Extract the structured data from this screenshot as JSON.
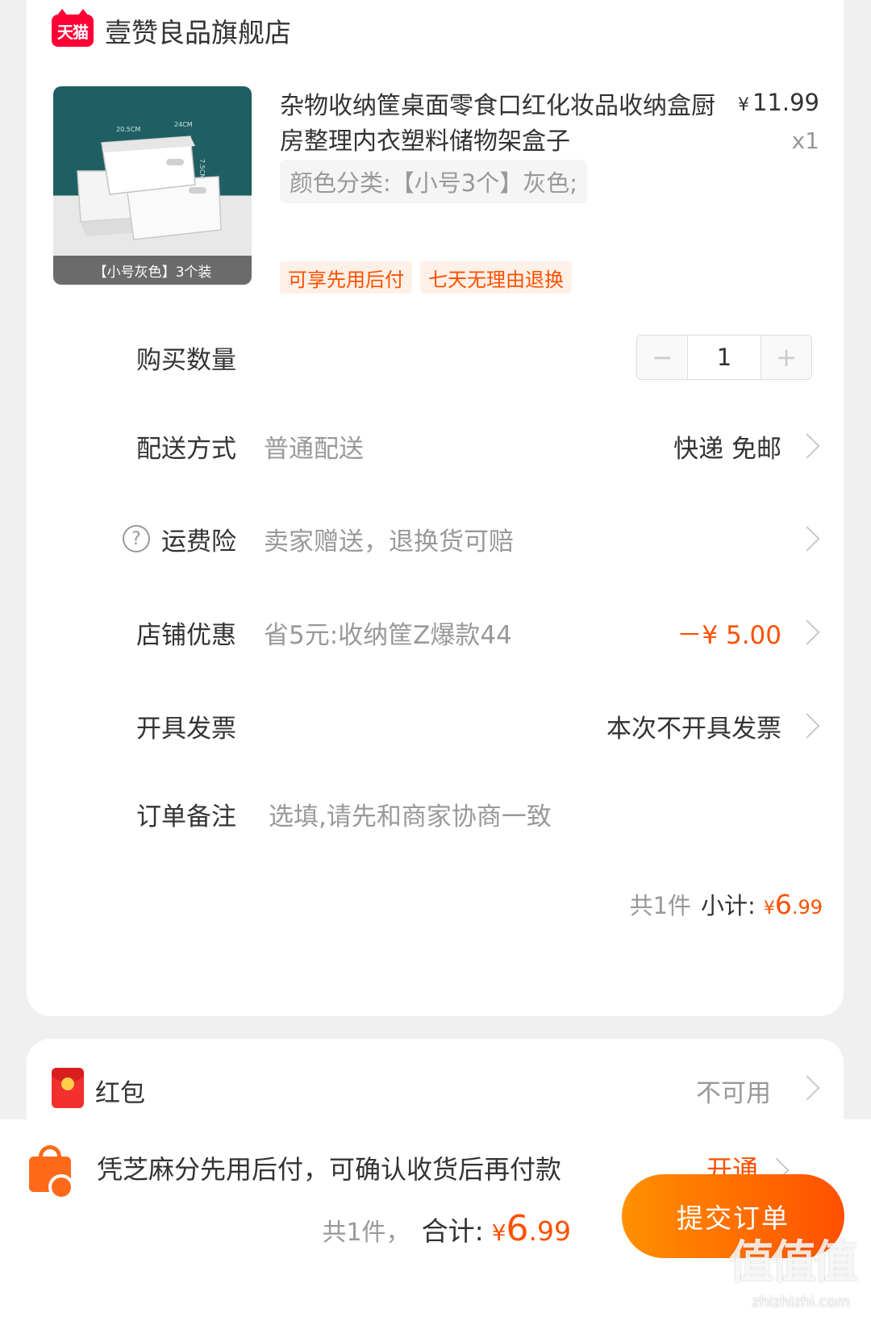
{
  "store": {
    "badge": "天猫",
    "name": "壹赞良品旗舰店"
  },
  "product": {
    "title": "杂物收纳筐桌面零食口红化妆品收纳盒厨房整理内衣塑料储物架盒子",
    "image_caption": "【小号灰色】3个装",
    "image_dims": [
      "20.5CM",
      "24CM",
      "7.5CM"
    ],
    "price_symbol": "¥",
    "price": "11.99",
    "quantity": "x1",
    "sku": "颜色分类:【小号3个】灰色;",
    "service_tags": [
      "可享先用后付",
      "七天无理由退换"
    ]
  },
  "rows": {
    "quantity": {
      "label": "购买数量",
      "value": "1",
      "minus": "−",
      "plus": "+"
    },
    "delivery": {
      "label": "配送方式",
      "desc": "普通配送",
      "value": "快递 免邮"
    },
    "shipping_insurance": {
      "label": "运费险",
      "help": "?",
      "desc": "卖家赠送，退换货可赔"
    },
    "store_discount": {
      "label": "店铺优惠",
      "desc": "省5元:收纳筐Z爆款44",
      "value": "－¥ 5.00"
    },
    "invoice": {
      "label": "开具发票",
      "value": "本次不开具发票"
    },
    "note": {
      "label": "订单备注",
      "placeholder": "选填,请先和商家协商一致"
    }
  },
  "subtotal": {
    "count": "共1件",
    "label": "小计:",
    "yen": "¥",
    "amount": "6",
    "cents": ".99"
  },
  "red_packet": {
    "label": "红包",
    "value": "不可用"
  },
  "banner": {
    "text": "凭芝麻分先用后付，可确认收货后再付款",
    "action": "开通"
  },
  "total": {
    "count": "共1件，",
    "label": "合计:",
    "yen": "¥",
    "amount": "6",
    "cents": ".99"
  },
  "submit": {
    "label": "提交订单"
  },
  "watermark": {
    "mark": "值值值",
    "url": "zhizhizhi.com"
  },
  "colors": {
    "accent": "#ff5000",
    "tmall_red": "#ff0036",
    "text_primary": "#333333",
    "text_secondary": "#999999",
    "background": "#f0f0f0"
  }
}
